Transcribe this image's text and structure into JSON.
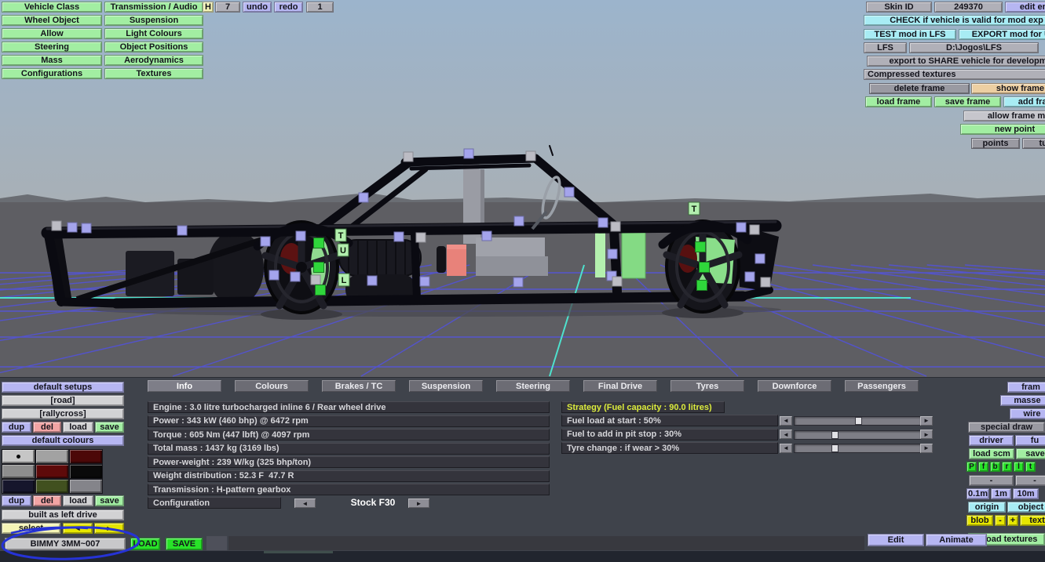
{
  "top_left_menu": {
    "col1": [
      "Vehicle Class",
      "Wheel Object",
      "Allow",
      "Steering",
      "Mass",
      "Configurations"
    ],
    "col2": [
      "Transmission / Audio",
      "Suspension",
      "Light Colours",
      "Object Positions",
      "Aerodynamics",
      "Textures"
    ]
  },
  "top_bar": {
    "history_label": "H",
    "history_value": "7",
    "undo": "undo",
    "redo": "redo",
    "count": "1"
  },
  "top_right": {
    "skin_id_label": "Skin ID",
    "skin_id_value": "249370",
    "edit_engine": "edit eng",
    "check": "CHECK if vehicle is valid for mod exp",
    "test": "TEST mod in LFS",
    "export_mod": "EXPORT mod for UP",
    "lfs": "LFS",
    "lfs_path": "D:\\Jogos\\LFS",
    "export_share": "export to SHARE vehicle for developm",
    "compressed": "Compressed textures",
    "delete_frame": "delete frame",
    "show_frame": "show frame",
    "load_frame": "load frame",
    "save_frame": "save frame",
    "add_frame": "add fram",
    "allow_frame": "allow frame m",
    "new_point": "new point",
    "points": "points",
    "tubes": "tub"
  },
  "left_panel": {
    "default_setups": "default setups",
    "setups": [
      "[road]",
      "[rallycross]"
    ],
    "dup": "dup",
    "del": "del",
    "load": "load",
    "save": "save",
    "default_colours": "default colours",
    "swatches": [
      [
        "#c6c6c6",
        "#a2a2a2",
        "#4c0808"
      ],
      [
        "#8e8e8e",
        "#5e0a0a",
        "#0a0a0a"
      ],
      [
        "#16162c",
        "#41501f",
        "#84848a"
      ]
    ],
    "built_as": "built as left drive",
    "select": "select",
    "prev": "◄",
    "next": "►",
    "vehicle_name": "BIMMY 3MM~007",
    "load_upper": "LOAD",
    "save_upper": "SAVE"
  },
  "tabs": [
    "Info",
    "Colours",
    "Brakes / TC",
    "Suspension",
    "Steering",
    "Final Drive",
    "Tyres",
    "Downforce",
    "Passengers"
  ],
  "active_tab": "Info",
  "info": {
    "rows": [
      "Engine : 3.0 litre turbocharged inline 6 / Rear wheel drive",
      "Power : 343 kW (460 bhp) @ 6472 rpm",
      "Torque : 605 Nm (447 lbft) @ 4097 rpm",
      "Total mass : 1437 kg (3169 lbs)",
      "Power-weight : 239 W/kg (325 bhp/ton)",
      "Weight distribution : 52.3 F  47.7 R",
      "Transmission : H-pattern gearbox"
    ],
    "config_label": "Configuration",
    "config_value": "Stock F30",
    "prev": "◄",
    "next": "►"
  },
  "strategy": {
    "header": "Strategy (Fuel capacity : 90.0 litres)",
    "rows": [
      {
        "label": "Fuel load at start : 50%",
        "percent": 50
      },
      {
        "label": "Fuel to add in pit stop : 30%",
        "percent": 30
      },
      {
        "label": "Tyre change : if wear > 30%",
        "percent": 30
      }
    ],
    "prev": "◄",
    "next": "►"
  },
  "right_panel": {
    "frames": "fram",
    "masses": "masse",
    "wire": "wire",
    "special_draw": "special draw",
    "driver": "driver",
    "fuel": "fu",
    "load_scm": "load scm",
    "save_scm": "save",
    "letters": [
      "P",
      "f",
      "b",
      "r",
      "l",
      "t"
    ],
    "minus1": "-",
    "minus2": "-",
    "scales": [
      "0.1m",
      "1m",
      "10m"
    ],
    "origin": "origin",
    "object": "object",
    "blob": "blob",
    "minus": "-",
    "plus": "+",
    "text": "text",
    "reload": "reload textures",
    "edit": "Edit",
    "animate": "Animate"
  },
  "viewport": {
    "wheel_labels": [
      "T",
      "U",
      "L"
    ],
    "rear_label": "T"
  },
  "scene_colors": {
    "handle_purple": "#a4a4ec",
    "handle_gray": "#bcbcc4",
    "cube_green": "#2fd63b",
    "tile_green": "#b2efae",
    "panel_green": "#8ade8a",
    "accent_cyan": "#4ee2ce",
    "grid_blue": "#5555d0",
    "brake_red": "#5c1212",
    "annotation_blue": "#2633d6"
  }
}
